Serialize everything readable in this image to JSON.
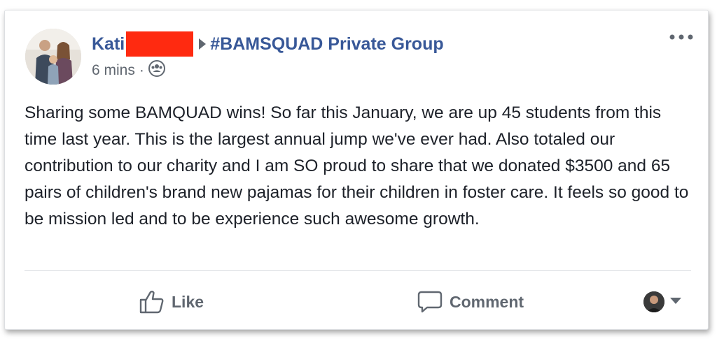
{
  "post": {
    "author": "Kati",
    "group": "#BAMSQUAD Private Group",
    "time": "6 mins",
    "separator": "·",
    "privacy_icon": "group-members-icon",
    "menu_icon": "more-options-icon",
    "text": "Sharing some BAMQUAD wins! So far this January, we are up 45 students from this time last year. This is the largest annual jump we've ever had. Also totaled our contribution to our charity and I am SO proud to share that we donated $3500 and 65 pairs of children's brand new pajamas for their children in foster care. It feels so good to be mission led and to be experience such awesome growth."
  },
  "actions": {
    "like_label": "Like",
    "comment_label": "Comment"
  },
  "colors": {
    "link": "#385898",
    "redaction": "#ff2a10",
    "secondary_text": "#606770",
    "body_text": "#1d2129"
  }
}
